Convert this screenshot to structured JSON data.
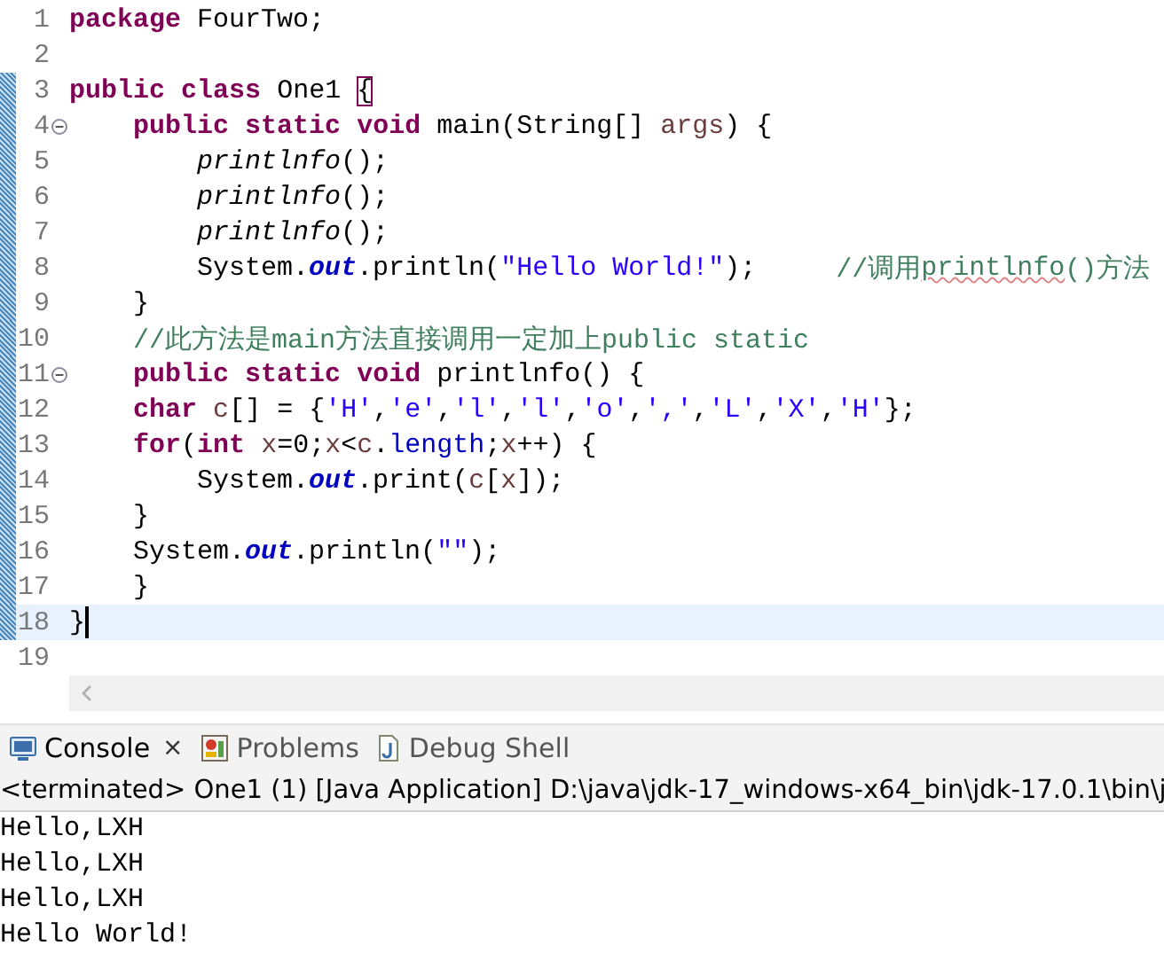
{
  "editor": {
    "lines": [
      {
        "number": "1",
        "changed": false,
        "collapsible": false,
        "current": false,
        "tokens": [
          {
            "kind": "keyword",
            "text": "package"
          },
          {
            "kind": "plain",
            "text": " FourTwo;"
          }
        ]
      },
      {
        "number": "2",
        "changed": false,
        "collapsible": false,
        "current": false
      },
      {
        "number": "3",
        "changed": true,
        "collapsible": false,
        "current": false,
        "tokens": [
          {
            "kind": "keyword",
            "text": "public"
          },
          {
            "kind": "keyword",
            "text": " class"
          },
          {
            "kind": "plain",
            "text": " One1 "
          },
          {
            "kind": "bracket-match",
            "text": "{"
          }
        ]
      },
      {
        "number": "4",
        "changed": true,
        "collapsible": true,
        "current": false,
        "tokens": [
          {
            "kind": "keyword",
            "text": "    public"
          },
          {
            "kind": "keyword",
            "text": " static"
          },
          {
            "kind": "keyword",
            "text": " void"
          },
          {
            "kind": "plain",
            "text": " main(String[] "
          },
          {
            "kind": "local",
            "text": "args"
          },
          {
            "kind": "plain",
            "text": ") {"
          }
        ]
      },
      {
        "number": "5",
        "changed": true,
        "collapsible": false,
        "current": false,
        "tokens": [
          {
            "kind": "static-call",
            "text": "        printlnfo"
          },
          {
            "kind": "plain",
            "text": "();"
          }
        ]
      },
      {
        "number": "6",
        "changed": true,
        "collapsible": false,
        "current": false,
        "tokens": [
          {
            "kind": "static-call",
            "text": "        printlnfo"
          },
          {
            "kind": "plain",
            "text": "();"
          }
        ]
      },
      {
        "number": "7",
        "changed": true,
        "collapsible": false,
        "current": false,
        "tokens": [
          {
            "kind": "static-call",
            "text": "        printlnfo"
          },
          {
            "kind": "plain",
            "text": "();"
          }
        ]
      },
      {
        "number": "8",
        "changed": true,
        "collapsible": false,
        "current": false,
        "tokens": [
          {
            "kind": "plain",
            "text": "        System."
          },
          {
            "kind": "field",
            "text": "out"
          },
          {
            "kind": "plain",
            "text": ".println("
          },
          {
            "kind": "string",
            "text": "\"Hello World!\""
          },
          {
            "kind": "plain",
            "text": ");     "
          },
          {
            "kind": "comment",
            "text": "//调用"
          },
          {
            "kind": "comment-misspelled",
            "text": "printlnfo"
          },
          {
            "kind": "comment",
            "text": "()方法"
          }
        ]
      },
      {
        "number": "9",
        "changed": true,
        "collapsible": false,
        "current": false,
        "tokens": [
          {
            "kind": "plain",
            "text": "    }"
          }
        ]
      },
      {
        "number": "10",
        "changed": true,
        "collapsible": false,
        "current": false,
        "tokens": [
          {
            "kind": "comment",
            "text": "    //此方法是main方法直接调用一定加上public static"
          }
        ]
      },
      {
        "number": "11",
        "changed": true,
        "collapsible": true,
        "current": false,
        "tokens": [
          {
            "kind": "keyword",
            "text": "    public"
          },
          {
            "kind": "keyword",
            "text": " static"
          },
          {
            "kind": "keyword",
            "text": " void"
          },
          {
            "kind": "plain",
            "text": " printlnfo() {"
          }
        ]
      },
      {
        "number": "12",
        "changed": true,
        "collapsible": false,
        "current": false,
        "tokens": [
          {
            "kind": "keyword",
            "text": "    char"
          },
          {
            "kind": "local",
            "text": " c"
          },
          {
            "kind": "plain",
            "text": "[] = {"
          },
          {
            "kind": "string",
            "text": "'H'"
          },
          {
            "kind": "plain",
            "text": ","
          },
          {
            "kind": "string",
            "text": "'e'"
          },
          {
            "kind": "plain",
            "text": ","
          },
          {
            "kind": "string",
            "text": "'l'"
          },
          {
            "kind": "plain",
            "text": ","
          },
          {
            "kind": "string",
            "text": "'l'"
          },
          {
            "kind": "plain",
            "text": ","
          },
          {
            "kind": "string",
            "text": "'o'"
          },
          {
            "kind": "plain",
            "text": ","
          },
          {
            "kind": "string",
            "text": "','"
          },
          {
            "kind": "plain",
            "text": ","
          },
          {
            "kind": "string",
            "text": "'L'"
          },
          {
            "kind": "plain",
            "text": ","
          },
          {
            "kind": "string",
            "text": "'X'"
          },
          {
            "kind": "plain",
            "text": ","
          },
          {
            "kind": "string",
            "text": "'H'"
          },
          {
            "kind": "plain",
            "text": "};"
          }
        ]
      },
      {
        "number": "13",
        "changed": true,
        "collapsible": false,
        "current": false,
        "tokens": [
          {
            "kind": "keyword",
            "text": "    for"
          },
          {
            "kind": "plain",
            "text": "("
          },
          {
            "kind": "keyword",
            "text": "int"
          },
          {
            "kind": "local",
            "text": " x"
          },
          {
            "kind": "plain",
            "text": "=0;"
          },
          {
            "kind": "local",
            "text": "x"
          },
          {
            "kind": "plain",
            "text": "<"
          },
          {
            "kind": "local",
            "text": "c"
          },
          {
            "kind": "plain",
            "text": "."
          },
          {
            "kind": "member",
            "text": "length"
          },
          {
            "kind": "plain",
            "text": ";"
          },
          {
            "kind": "local",
            "text": "x"
          },
          {
            "kind": "plain",
            "text": "++) {"
          }
        ]
      },
      {
        "number": "14",
        "changed": true,
        "collapsible": false,
        "current": false,
        "tokens": [
          {
            "kind": "plain",
            "text": "        System."
          },
          {
            "kind": "field",
            "text": "out"
          },
          {
            "kind": "plain",
            "text": ".print("
          },
          {
            "kind": "local",
            "text": "c"
          },
          {
            "kind": "plain",
            "text": "["
          },
          {
            "kind": "local",
            "text": "x"
          },
          {
            "kind": "plain",
            "text": "]);"
          }
        ]
      },
      {
        "number": "15",
        "changed": true,
        "collapsible": false,
        "current": false,
        "tokens": [
          {
            "kind": "plain",
            "text": "    }"
          }
        ]
      },
      {
        "number": "16",
        "changed": true,
        "collapsible": false,
        "current": false,
        "tokens": [
          {
            "kind": "plain",
            "text": "    System."
          },
          {
            "kind": "field",
            "text": "out"
          },
          {
            "kind": "plain",
            "text": ".println("
          },
          {
            "kind": "string",
            "text": "\"\""
          },
          {
            "kind": "plain",
            "text": ");"
          }
        ]
      },
      {
        "number": "17",
        "changed": true,
        "collapsible": false,
        "current": false,
        "tokens": [
          {
            "kind": "plain",
            "text": "    }"
          }
        ]
      },
      {
        "number": "18",
        "changed": true,
        "collapsible": false,
        "current": true,
        "tokens": [
          {
            "kind": "plain",
            "text": "}"
          }
        ]
      },
      {
        "number": "19",
        "changed": false,
        "collapsible": false,
        "current": false
      }
    ]
  },
  "console": {
    "tabs": [
      {
        "kind": "console",
        "label": "Console",
        "close": "×",
        "selected": true
      },
      {
        "kind": "problems",
        "label": "Problems",
        "selected": false
      },
      {
        "kind": "debug-shell",
        "label": "Debug Shell",
        "selected": false
      }
    ],
    "status": "<terminated> One1 (1) [Java Application] D:\\java\\jdk-17_windows-x64_bin\\jdk-17.0.1\\bin\\j",
    "output": [
      "Hello,LXH",
      "Hello,LXH",
      "Hello,LXH",
      "Hello World!"
    ]
  }
}
